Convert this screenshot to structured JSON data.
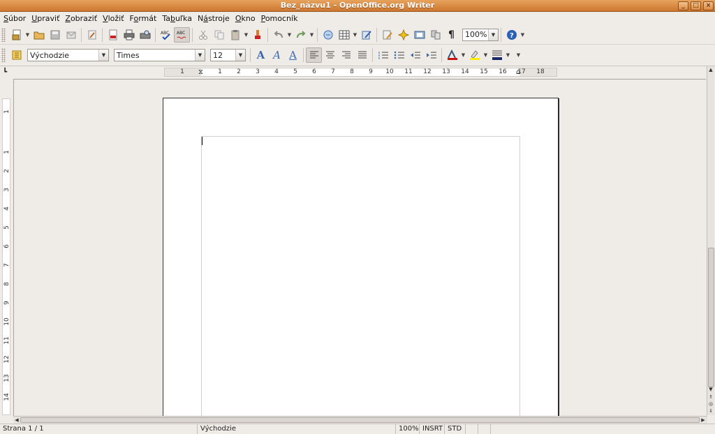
{
  "window": {
    "title": "Bez_názvu1 - OpenOffice.org Writer"
  },
  "menu": [
    {
      "label": "Súbor",
      "mnemonic": "S"
    },
    {
      "label": "Upraviť",
      "mnemonic": "U"
    },
    {
      "label": "Zobraziť",
      "mnemonic": "Z"
    },
    {
      "label": "Vložiť",
      "mnemonic": "V"
    },
    {
      "label": "Formát",
      "mnemonic": "o"
    },
    {
      "label": "Tabuľka",
      "mnemonic": "b"
    },
    {
      "label": "Nástroje",
      "mnemonic": "á"
    },
    {
      "label": "Okno",
      "mnemonic": "O"
    },
    {
      "label": "Pomocník",
      "mnemonic": "P"
    }
  ],
  "toolbar": {
    "zoom": "100%"
  },
  "formatting": {
    "paragraph_style": "Východzie",
    "font_name": "Times",
    "font_size": "12"
  },
  "ruler": {
    "h_numbers": [
      "1",
      "1",
      "2",
      "3",
      "4",
      "5",
      "6",
      "7",
      "8",
      "9",
      "10",
      "11",
      "12",
      "13",
      "14",
      "15",
      "16",
      "17",
      "18"
    ],
    "v_numbers": [
      "1",
      "1",
      "2",
      "3",
      "4",
      "5",
      "6",
      "7",
      "8",
      "9",
      "10",
      "11",
      "12",
      "13",
      "14"
    ]
  },
  "status": {
    "page": "Strana 1 / 1",
    "style": "Východzie",
    "zoom": "100%",
    "insert_mode": "INSRT",
    "selection_mode": "STD"
  },
  "colors": {
    "titlebar": "#d9873f",
    "font_color": "#cc1111",
    "highlight": "#ffee00",
    "background_color": "#1a2a66"
  }
}
